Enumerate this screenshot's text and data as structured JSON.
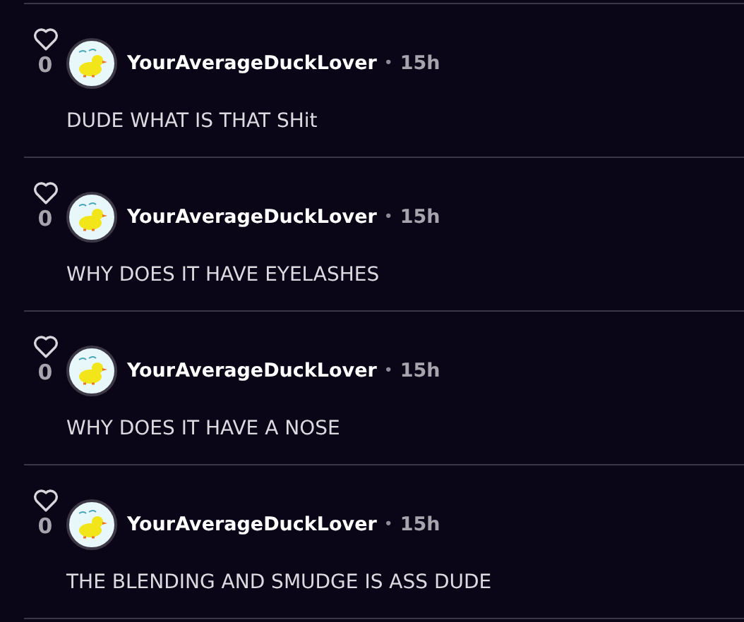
{
  "comments": [
    {
      "likes": "0",
      "liked": false,
      "author": "YourAverageDuckLover",
      "separator": "•",
      "time": "15h",
      "text": "DUDE WHAT IS THAT SHit"
    },
    {
      "likes": "0",
      "liked": false,
      "author": "YourAverageDuckLover",
      "separator": "•",
      "time": "15h",
      "text": "WHY DOES IT HAVE EYELASHES"
    },
    {
      "likes": "0",
      "liked": false,
      "author": "YourAverageDuckLover",
      "separator": "•",
      "time": "15h",
      "text": "WHY DOES IT HAVE A NOSE"
    },
    {
      "likes": "0",
      "liked": false,
      "author": "YourAverageDuckLover",
      "separator": "•",
      "time": "15h",
      "text": "THE BLENDING AND SMUDGE IS ASS DUDE"
    }
  ]
}
